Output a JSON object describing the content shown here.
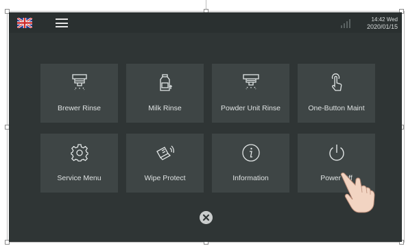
{
  "header": {
    "time_day": "14:42 Wed",
    "date": "2020/01/15",
    "language_icon": "uk-flag-icon",
    "menu_icon": "hamburger-menu-icon",
    "signal_icon": "signal-bars-icon"
  },
  "tiles": [
    {
      "label": "Brewer Rinse",
      "icon": "brewer-rinse-icon"
    },
    {
      "label": "Milk Rinse",
      "icon": "milk-rinse-icon"
    },
    {
      "label": "Powder Unit Rinse",
      "icon": "powder-rinse-icon"
    },
    {
      "label": "One-Button Maint",
      "icon": "touch-finger-icon"
    },
    {
      "label": "Service Menu",
      "icon": "gear-icon"
    },
    {
      "label": "Wipe Protect",
      "icon": "wipe-hand-icon"
    },
    {
      "label": "Information",
      "icon": "info-icon"
    },
    {
      "label": "Power Off",
      "icon": "power-icon"
    }
  ],
  "footer": {
    "close_icon": "close-icon"
  },
  "colors": {
    "screen_bg": "#2f3535",
    "tile_bg": "#3e4545",
    "text": "#dfe3e3"
  }
}
